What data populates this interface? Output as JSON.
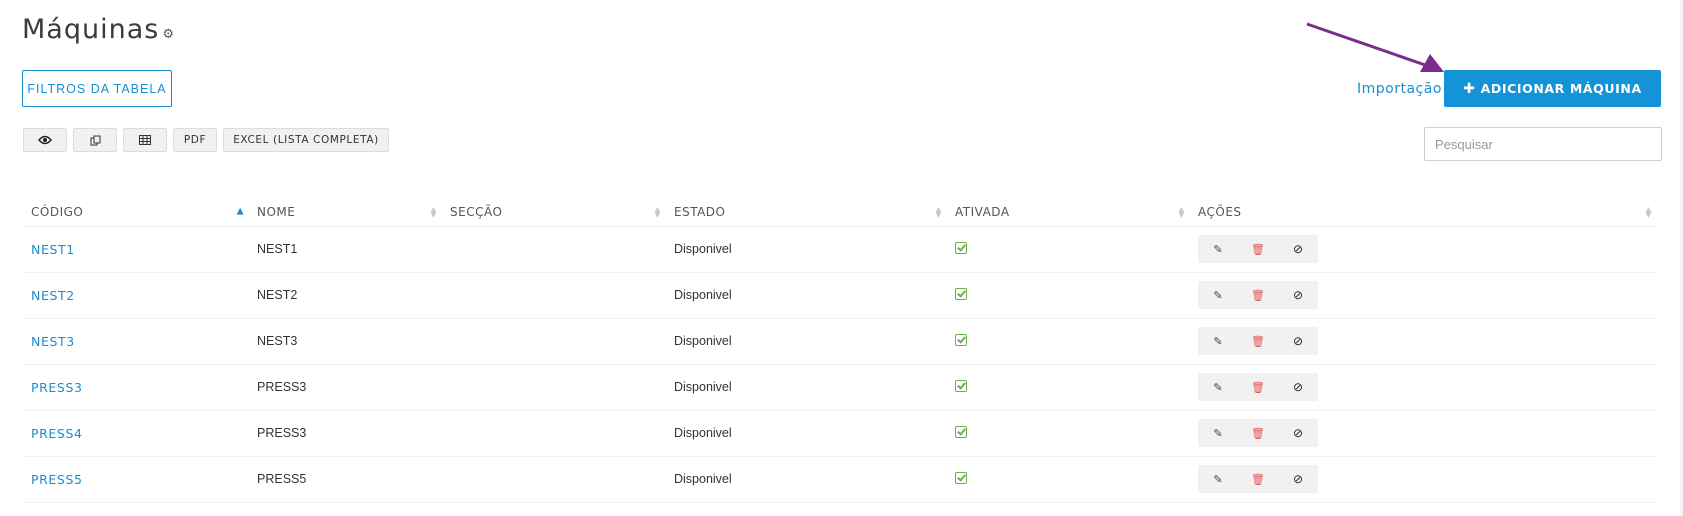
{
  "page": {
    "title": "Máquinas",
    "gear_icon": "gear-icon"
  },
  "toolbar": {
    "filters_label": "FILTROS DA TABELA",
    "import_label": "Importação",
    "add_label": "ADICIONAR MÁQUINA",
    "add_icon": "plus-icon",
    "export_buttons": {
      "visibility_icon": "eye-icon",
      "copy_icon": "copy-icon",
      "csv_icon": "table-icon",
      "pdf_label": "PDF",
      "excel_label": "EXCEL (LISTA COMPLETA)"
    },
    "search_placeholder": "Pesquisar"
  },
  "table": {
    "columns": [
      "CÓDIGO",
      "NOME",
      "SECÇÃO",
      "ESTADO",
      "ATIVADA",
      "AÇÕES"
    ],
    "sorted_column": "CÓDIGO",
    "rows": [
      {
        "code": "NEST1",
        "name": "NEST1",
        "section": "",
        "status": "Disponivel",
        "active": true
      },
      {
        "code": "NEST2",
        "name": "NEST2",
        "section": "",
        "status": "Disponivel",
        "active": true
      },
      {
        "code": "NEST3",
        "name": "NEST3",
        "section": "",
        "status": "Disponivel",
        "active": true
      },
      {
        "code": "PRESS3",
        "name": "PRESS3",
        "section": "",
        "status": "Disponivel",
        "active": true
      },
      {
        "code": "PRESS4",
        "name": "PRESS3",
        "section": "",
        "status": "Disponivel",
        "active": true
      },
      {
        "code": "PRESS5",
        "name": "PRESS5",
        "section": "",
        "status": "Disponivel",
        "active": true
      }
    ]
  },
  "colors": {
    "accent": "#1493d8",
    "link": "#1a8dcf",
    "check": "#6ab04c",
    "delete": "#e05555",
    "annotation_arrow": "#7b2d8e"
  }
}
